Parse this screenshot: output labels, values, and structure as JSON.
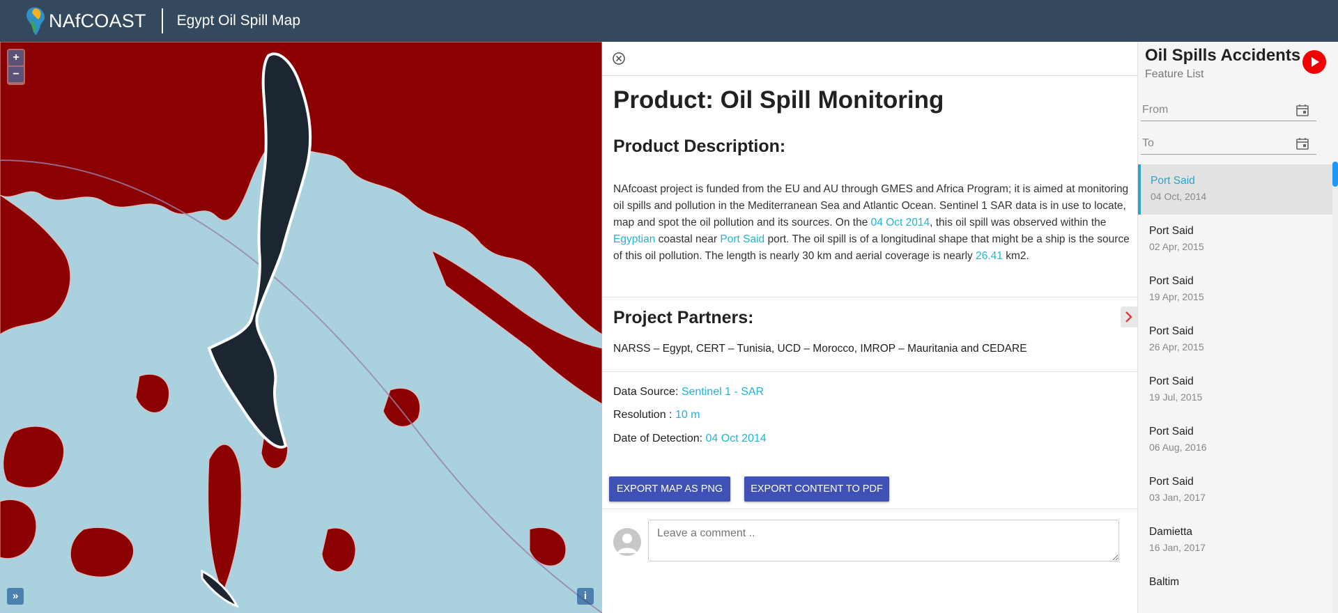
{
  "header": {
    "logo_text": "NAfCOAST",
    "app_title": "Egypt Oil Spill Map"
  },
  "map": {
    "zoom_in": "+",
    "zoom_out": "−",
    "expand_label": "»",
    "info_label": "i",
    "colors": {
      "water": "#a9d2de",
      "land": "#8b0000",
      "spill": "#1b2631"
    }
  },
  "detail": {
    "product_title": "Product: Oil Spill Monitoring",
    "description_heading": "Product Description:",
    "description": {
      "part1": "NAfcoast project is funded from the EU and AU through GMES and Africa Program; it is aimed at monitoring oil spills and pollution in the Mediterranean Sea and Atlantic Ocean. Sentinel 1 SAR data is in use to locate, map and spot the oil pollution and its sources. On the ",
      "date": "04 Oct 2014",
      "part2": ", this oil spill was observed within the ",
      "country": "Egyptian",
      "part3": " coastal near ",
      "port": "Port Said",
      "part4": " port. The oil spill is of a longitudinal shape that might be a ship is the source of this oil pollution. The length is nearly 30 km and aerial coverage is nearly ",
      "area": "26.41",
      "part5": " km2."
    },
    "partners_heading": "Project Partners:",
    "partners": "NARSS – Egypt, CERT – Tunisia, UCD – Morocco, IMROP – Mauritania and CEDARE",
    "data_source_label": "Data Source: ",
    "data_source_value": "Sentinel 1 - SAR",
    "resolution_label": "Resolution : ",
    "resolution_value": "10 m",
    "detection_label": "Date of Detection: ",
    "detection_value": "04 Oct 2014",
    "export_png": "EXPORT MAP AS PNG",
    "export_pdf": "EXPORT CONTENT TO PDF",
    "comment_placeholder": "Leave a comment ..",
    "accent_color": "#1fb5d4",
    "button_color": "#3f51b5"
  },
  "sidebar": {
    "title": "Oil Spills Accidents",
    "subtitle": "Feature List",
    "from_label": "From",
    "to_label": "To",
    "items": [
      {
        "name": "Port Said",
        "date": "04 Oct, 2014"
      },
      {
        "name": "Port Said",
        "date": "02 Apr, 2015"
      },
      {
        "name": "Port Said",
        "date": "19 Apr, 2015"
      },
      {
        "name": "Port Said",
        "date": "26 Apr, 2015"
      },
      {
        "name": "Port Said",
        "date": "19 Jul, 2015"
      },
      {
        "name": "Port Said",
        "date": "06 Aug, 2016"
      },
      {
        "name": "Port Said",
        "date": "03 Jan, 2017"
      },
      {
        "name": "Damietta",
        "date": "16 Jan, 2017"
      },
      {
        "name": "Baltim",
        "date": ""
      }
    ]
  }
}
